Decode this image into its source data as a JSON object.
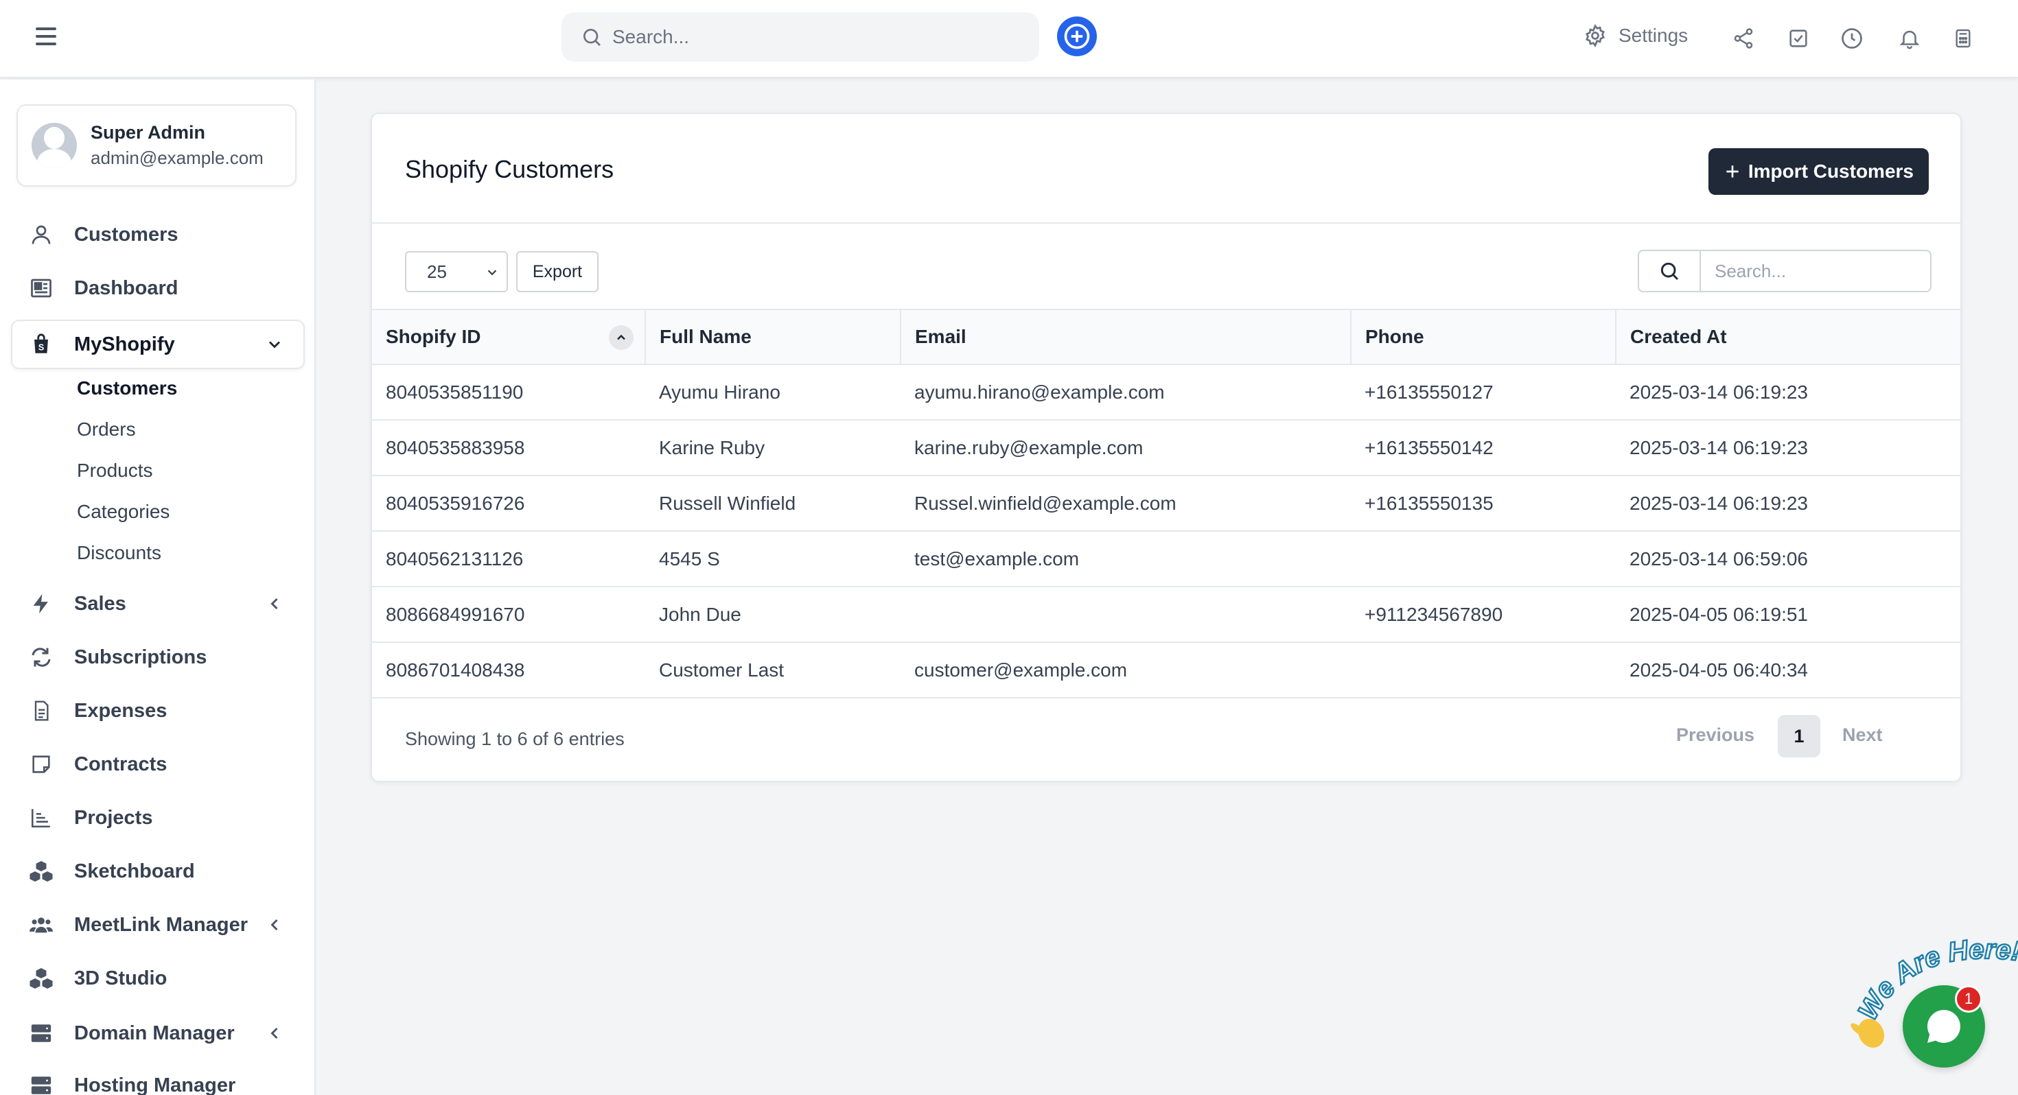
{
  "topbar": {
    "search_placeholder": "Search...",
    "settings_label": "Settings"
  },
  "colors": {
    "accent": "#2563eb",
    "import_button_bg": "#1f2937",
    "chat_green": "#22a04a",
    "badge_red": "#dc2626"
  },
  "profile": {
    "name": "Super Admin",
    "email": "admin@example.com"
  },
  "sidebar": {
    "items": [
      {
        "label": "Customers",
        "icon": "user-icon"
      },
      {
        "label": "Dashboard",
        "icon": "dashboard-icon"
      },
      {
        "label": "MyShopify",
        "icon": "shopify-bag-icon"
      },
      {
        "label": "Sales",
        "icon": "lightning-icon"
      },
      {
        "label": "Subscriptions",
        "icon": "repeat-icon"
      },
      {
        "label": "Expenses",
        "icon": "document-icon"
      },
      {
        "label": "Contracts",
        "icon": "note-icon"
      },
      {
        "label": "Projects",
        "icon": "chart-icon"
      },
      {
        "label": "Sketchboard",
        "icon": "cubes-icon"
      },
      {
        "label": "MeetLink Manager",
        "icon": "users-icon"
      },
      {
        "label": "3D Studio",
        "icon": "cubes-icon"
      },
      {
        "label": "Domain Manager",
        "icon": "server-icon"
      },
      {
        "label": "Hosting Manager",
        "icon": "server-icon"
      }
    ],
    "sub_items": [
      "Customers",
      "Orders",
      "Products",
      "Categories",
      "Discounts"
    ]
  },
  "card": {
    "title": "Shopify Customers",
    "import_label": "Import Customers",
    "page_size": "25",
    "export_label": "Export",
    "search_placeholder": "Search..."
  },
  "table": {
    "headers": [
      "Shopify ID",
      "Full Name",
      "Email",
      "Phone",
      "Created At"
    ],
    "rows": [
      [
        "8040535851190",
        "Ayumu Hirano",
        "ayumu.hirano@example.com",
        "+16135550127",
        "2025-03-14 06:19:23"
      ],
      [
        "8040535883958",
        "Karine Ruby",
        "karine.ruby@example.com",
        "+16135550142",
        "2025-03-14 06:19:23"
      ],
      [
        "8040535916726",
        "Russell Winfield",
        "Russel.winfield@example.com",
        "+16135550135",
        "2025-03-14 06:19:23"
      ],
      [
        "8040562131126",
        "4545 S",
        "test@example.com",
        "",
        "2025-03-14 06:59:06"
      ],
      [
        "8086684991670",
        "John Due",
        "",
        "+911234567890",
        "2025-04-05 06:19:51"
      ],
      [
        "8086701408438",
        "Customer Last",
        "customer@example.com",
        "",
        "2025-04-05 06:40:34"
      ]
    ]
  },
  "pagination": {
    "showing": "Showing 1 to 6 of 6 entries",
    "previous": "Previous",
    "current_page": "1",
    "next": "Next"
  },
  "chat": {
    "tagline": "We Are Here!",
    "badge_count": "1"
  }
}
